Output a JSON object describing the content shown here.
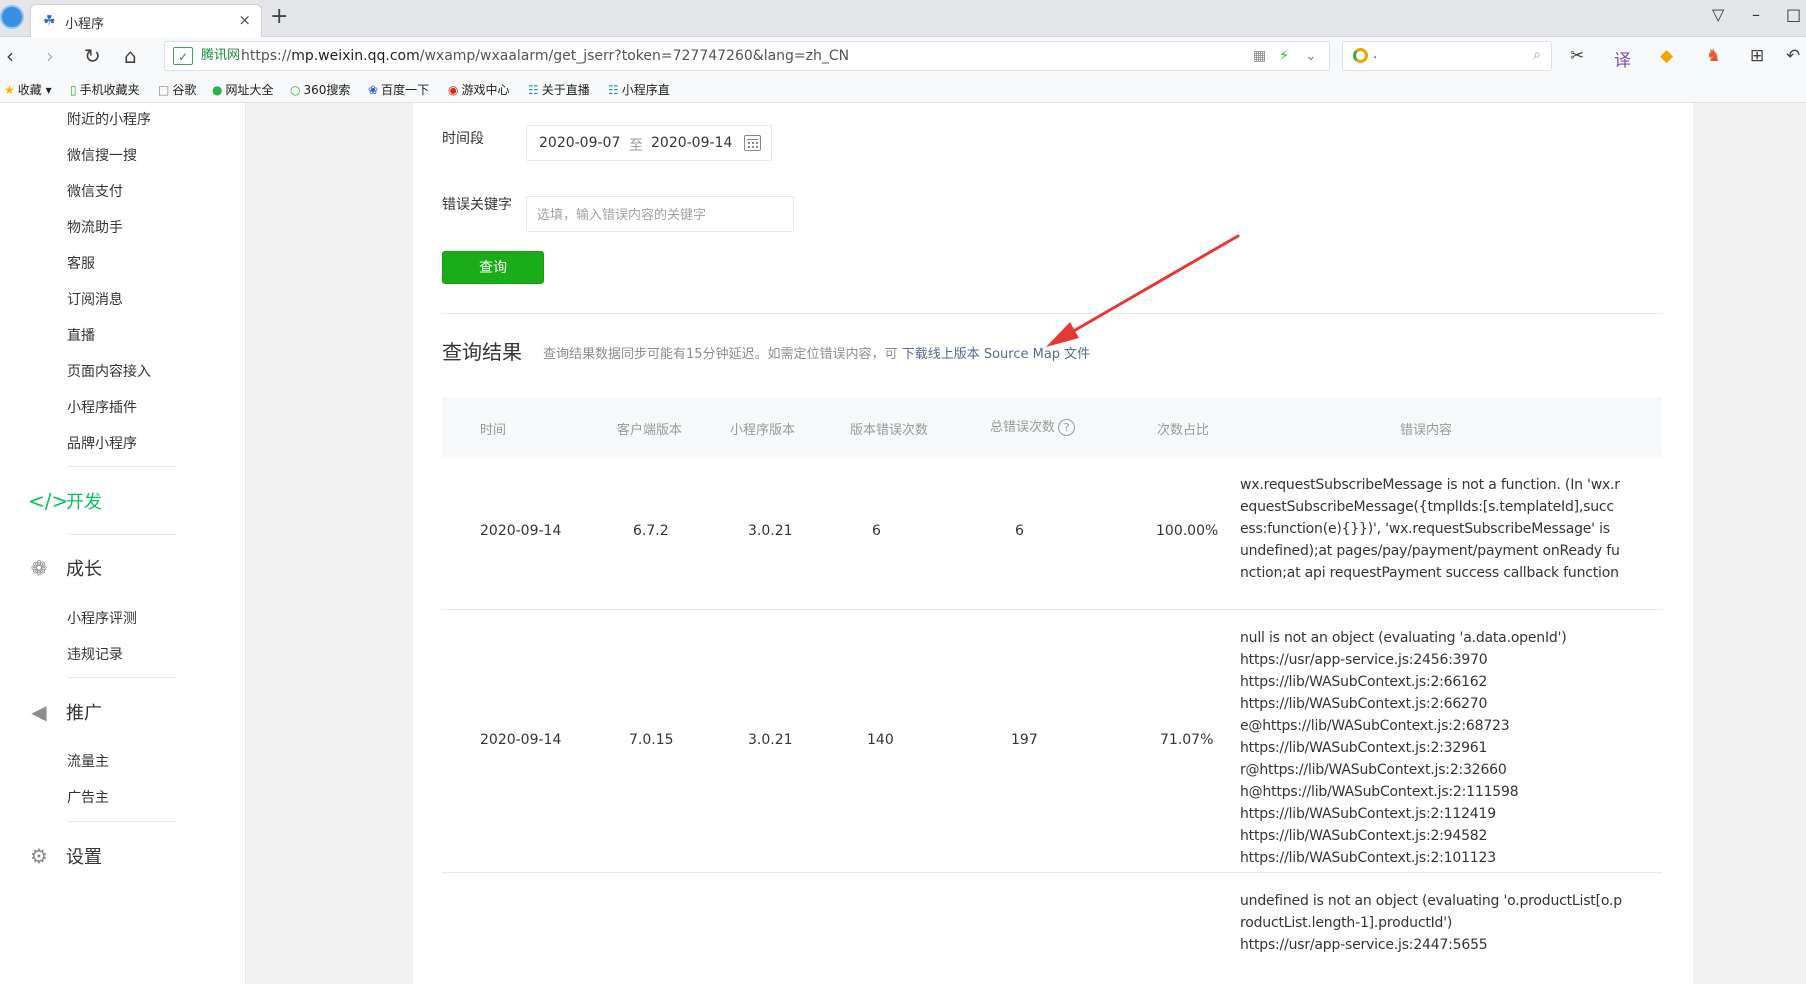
{
  "browser": {
    "tab_title": "小程序",
    "tab_close": "×",
    "new_tab": "+",
    "secure_text": "腾讯网",
    "url_scheme": "https://",
    "url_host": "mp.weixin.qq.com",
    "url_path": "/wxamp/wxaalarm/get_jserr?token=727747260&lang=zh_CN",
    "search_text": ".",
    "icons": [
      "back-icon",
      "forward-icon",
      "reload-icon",
      "home-icon",
      "qr-icon",
      "bolt-icon",
      "dropdown-icon",
      "search-icon",
      "scissors-icon",
      "translate-icon",
      "shield-icon",
      "game-icon",
      "apps-icon",
      "undo-icon"
    ],
    "bookmarks": [
      "收藏",
      "手机收藏夹",
      "谷歌",
      "网址大全",
      "360搜索",
      "百度一下",
      "游戏中心",
      "关于直播",
      "小程序直"
    ]
  },
  "sidebar": {
    "items_top": [
      "附近的小程序",
      "微信搜一搜",
      "微信支付",
      "物流助手",
      "客服",
      "订阅消息",
      "直播",
      "页面内容接入",
      "小程序插件",
      "品牌小程序"
    ],
    "group_dev": "开发",
    "group_growth": "成长",
    "growth_items": [
      "小程序评测",
      "违规记录"
    ],
    "group_promo": "推广",
    "promo_items": [
      "流量主",
      "广告主"
    ],
    "group_settings": "设置"
  },
  "filter": {
    "period_label": "时间段",
    "date_start": "2020-09-07",
    "date_sep": "至",
    "date_end": "2020-09-14",
    "keyword_label": "错误关键字",
    "keyword_placeholder": "选填，输入错误内容的关键字",
    "query_button": "查询"
  },
  "results": {
    "title": "查询结果",
    "note": "查询结果数据同步可能有15分钟延迟。如需定位错误内容，可 ",
    "link": "下载线上版本 Source Map 文件",
    "columns": [
      "时间",
      "客户端版本",
      "小程序版本",
      "版本错误次数",
      "总错误次数",
      "次数占比",
      "错误内容"
    ],
    "help_glyph": "?",
    "rows": [
      {
        "time": "2020-09-14",
        "client_version": "6.7.2",
        "app_version": "3.0.21",
        "version_errors": "6",
        "total_errors": "6",
        "ratio": "100.00%",
        "content": "wx.requestSubscribeMessage is not a function. (In 'wx.requestSubscribeMessage({tmplIds:[s.templateId],success:function(e){}})', 'wx.requestSubscribeMessage' is undefined);at pages/pay/payment/payment onReady function;at api requestPayment success callback function"
      },
      {
        "time": "2020-09-14",
        "client_version": "7.0.15",
        "app_version": "3.0.21",
        "version_errors": "140",
        "total_errors": "197",
        "ratio": "71.07%",
        "content": "null is not an object (evaluating 'a.data.openId')\nhttps://usr/app-service.js:2456:3970\nhttps://lib/WASubContext.js:2:66162\nhttps://lib/WASubContext.js:2:66270\ne@https://lib/WASubContext.js:2:68723\nhttps://lib/WASubContext.js:2:32961\nr@https://lib/WASubContext.js:2:32660\nh@https://lib/WASubContext.js:2:111598\nhttps://lib/WASubContext.js:2:112419\nhttps://lib/WASubContext.js:2:94582\nhttps://lib/WASubContext.js:2:101123"
      },
      {
        "content": "undefined is not an object (evaluating 'o.productList[o.productList.length-1].productId')\nhttps://usr/app-service.js:2447:5655"
      }
    ]
  },
  "colors": {
    "accent_green": "#1aad19",
    "active_nav": "#07c160",
    "link": "#576b95",
    "annotation_arrow": "#e53935"
  }
}
